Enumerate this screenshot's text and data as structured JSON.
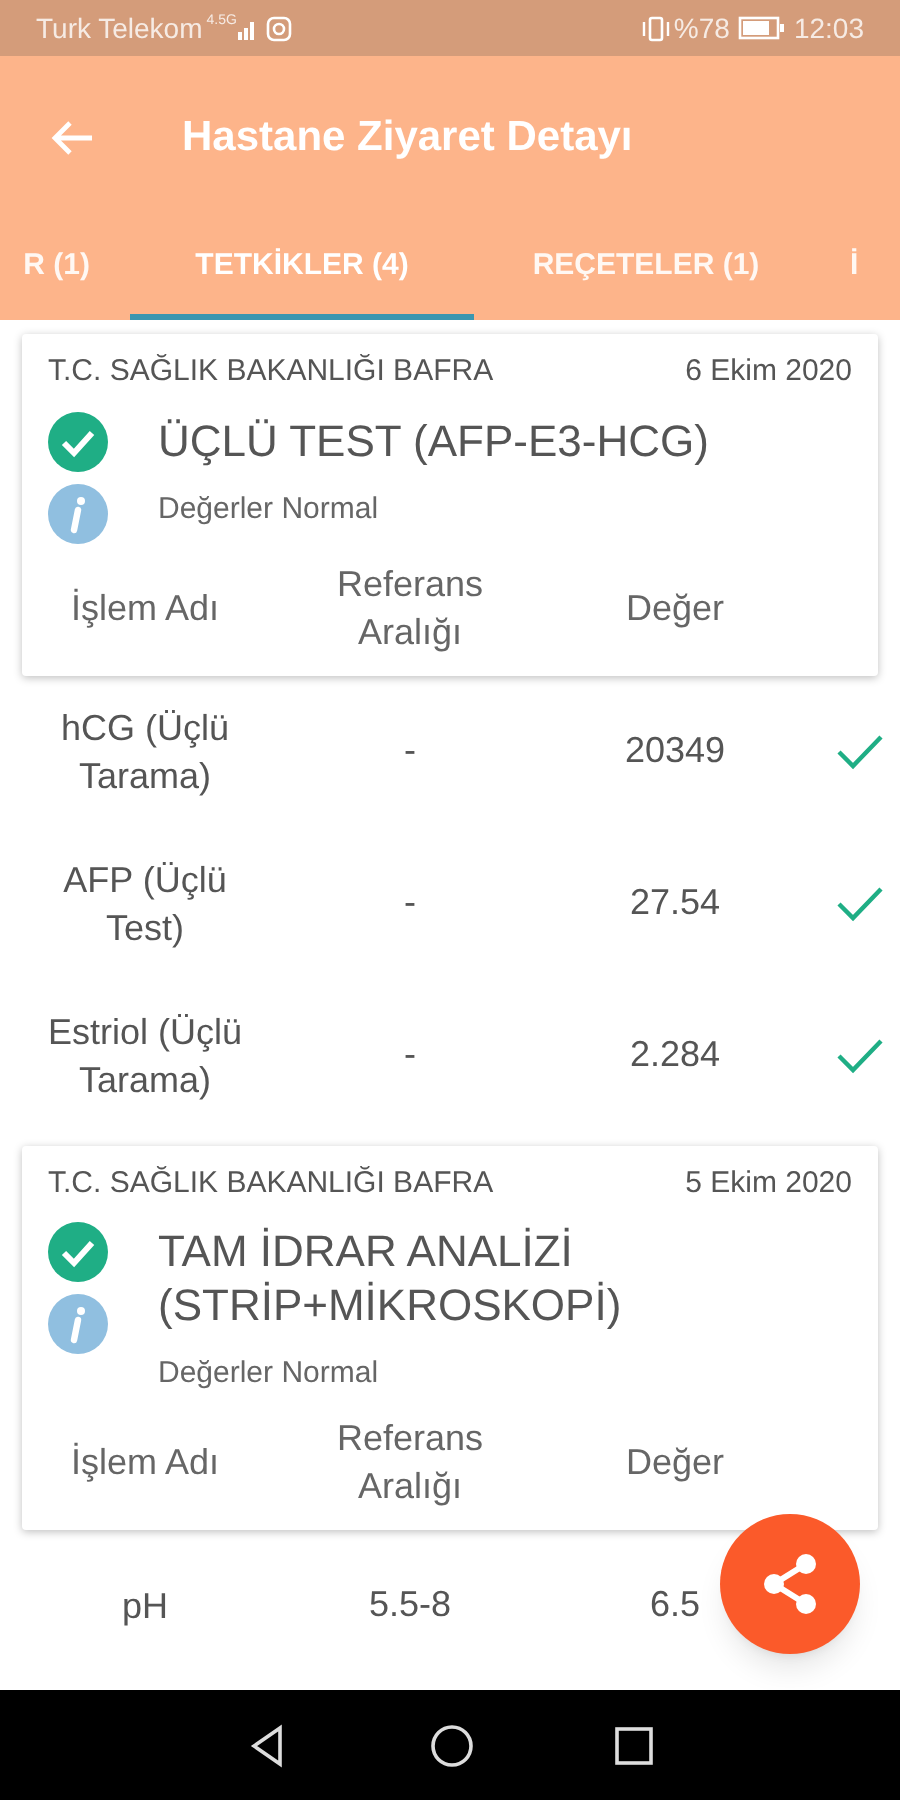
{
  "status_bar": {
    "carrier": "Turk Telekom",
    "network": "4.5G",
    "battery": "%78",
    "time": "12:03"
  },
  "app_bar": {
    "title": "Hastane Ziyaret Detayı"
  },
  "tabs": [
    {
      "label": "R (1)",
      "selected": false
    },
    {
      "label": "TETKİKLER (4)",
      "selected": true
    },
    {
      "label": "REÇETELER (1)",
      "selected": false
    },
    {
      "label": "İ",
      "selected": false
    }
  ],
  "tests": [
    {
      "institution": "T.C. SAĞLIK BAKANLIĞI BAFRA",
      "date": "6 Ekim 2020",
      "name": "ÜÇLÜ TEST (AFP-E3-HCG)",
      "result": "Değerler Normal",
      "columns": [
        "İşlem Adı",
        "Referans Aralığı",
        "Değer"
      ],
      "rows": [
        {
          "name": "hCG (Üçlü Tarama)",
          "reference": "-",
          "value": "20349",
          "checked": true
        },
        {
          "name": "AFP (Üçlü Test)",
          "reference": "-",
          "value": "27.54",
          "checked": true
        },
        {
          "name": "Estriol (Üçlü Tarama)",
          "reference": "-",
          "value": "2.284",
          "checked": true
        }
      ]
    },
    {
      "institution": "T.C. SAĞLIK BAKANLIĞI BAFRA",
      "date": "5 Ekim 2020",
      "name": "TAM İDRAR ANALİZİ (STRİP+MİKROSKOPİ)",
      "result": "Değerler Normal",
      "columns": [
        "İşlem Adı",
        "Referans Aralığı",
        "Değer"
      ],
      "rows": [
        {
          "name": "pH",
          "reference": "5.5-8",
          "value": "6.5",
          "checked": false
        }
      ]
    }
  ]
}
